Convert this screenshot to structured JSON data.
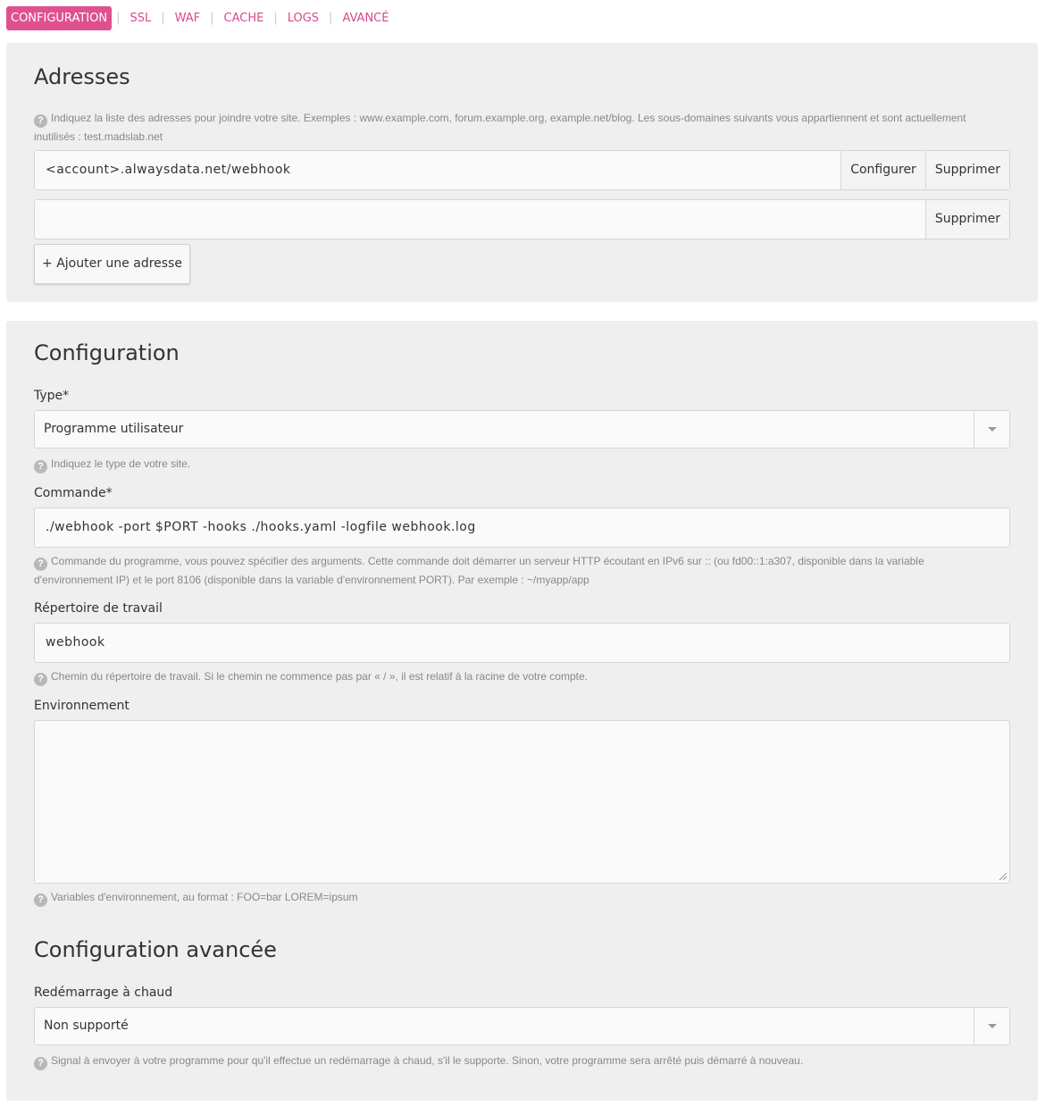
{
  "tabs": [
    {
      "label": "CONFIGURATION",
      "active": true
    },
    {
      "label": "SSL"
    },
    {
      "label": "WAF"
    },
    {
      "label": "CACHE"
    },
    {
      "label": "LOGS"
    },
    {
      "label": "AVANCÉ"
    }
  ],
  "addresses": {
    "title": "Adresses",
    "help": "Indiquez la liste des adresses pour joindre votre site. Exemples : www.example.com, forum.example.org, example.net/blog. Les sous-domaines suivants vous appartiennent et sont actuellement inutilisés : test.madslab.net",
    "rows": [
      {
        "value": "<account>.alwaysdata.net/webhook",
        "configure_label": "Configurer",
        "delete_label": "Supprimer"
      },
      {
        "value": "",
        "delete_label": "Supprimer"
      }
    ],
    "add_label": "+ Ajouter une adresse"
  },
  "configuration": {
    "title": "Configuration",
    "type": {
      "label": "Type*",
      "value": "Programme utilisateur",
      "help": "Indiquez le type de votre site."
    },
    "command": {
      "label": "Commande*",
      "value": "./webhook -port $PORT -hooks ./hooks.yaml -logfile webhook.log",
      "help": "Commande du programme, vous pouvez spécifier des arguments. Cette commande doit démarrer un serveur HTTP écoutant en IPv6 sur :: (ou fd00::1:a307, disponible dans la variable d'environnement IP) et le port 8106 (disponible dans la variable d'environnement PORT). Par exemple : ~/myapp/app"
    },
    "workdir": {
      "label": "Répertoire de travail",
      "value": "webhook",
      "help": "Chemin du répertoire de travail. Si le chemin ne commence pas par « / », il est relatif à la racine de votre compte."
    },
    "environment": {
      "label": "Environnement",
      "value": "",
      "help": "Variables d'environnement, au format : FOO=bar LOREM=ipsum"
    }
  },
  "advanced": {
    "title": "Configuration avancée",
    "hot_restart": {
      "label": "Redémarrage à chaud",
      "value": "Non supporté",
      "help": "Signal à envoyer à votre programme pour qu'il effectue un redémarrage à chaud, s'il le supporte. Sinon, votre programme sera arrêté puis démarré à nouveau."
    }
  },
  "colors": {
    "accent": "#e0508f",
    "link": "#d84b8c",
    "panel": "#efefef"
  },
  "icons": {
    "help": "question-circle-icon",
    "dropdown": "caret-down-icon",
    "resize": "resize-grip-icon"
  }
}
